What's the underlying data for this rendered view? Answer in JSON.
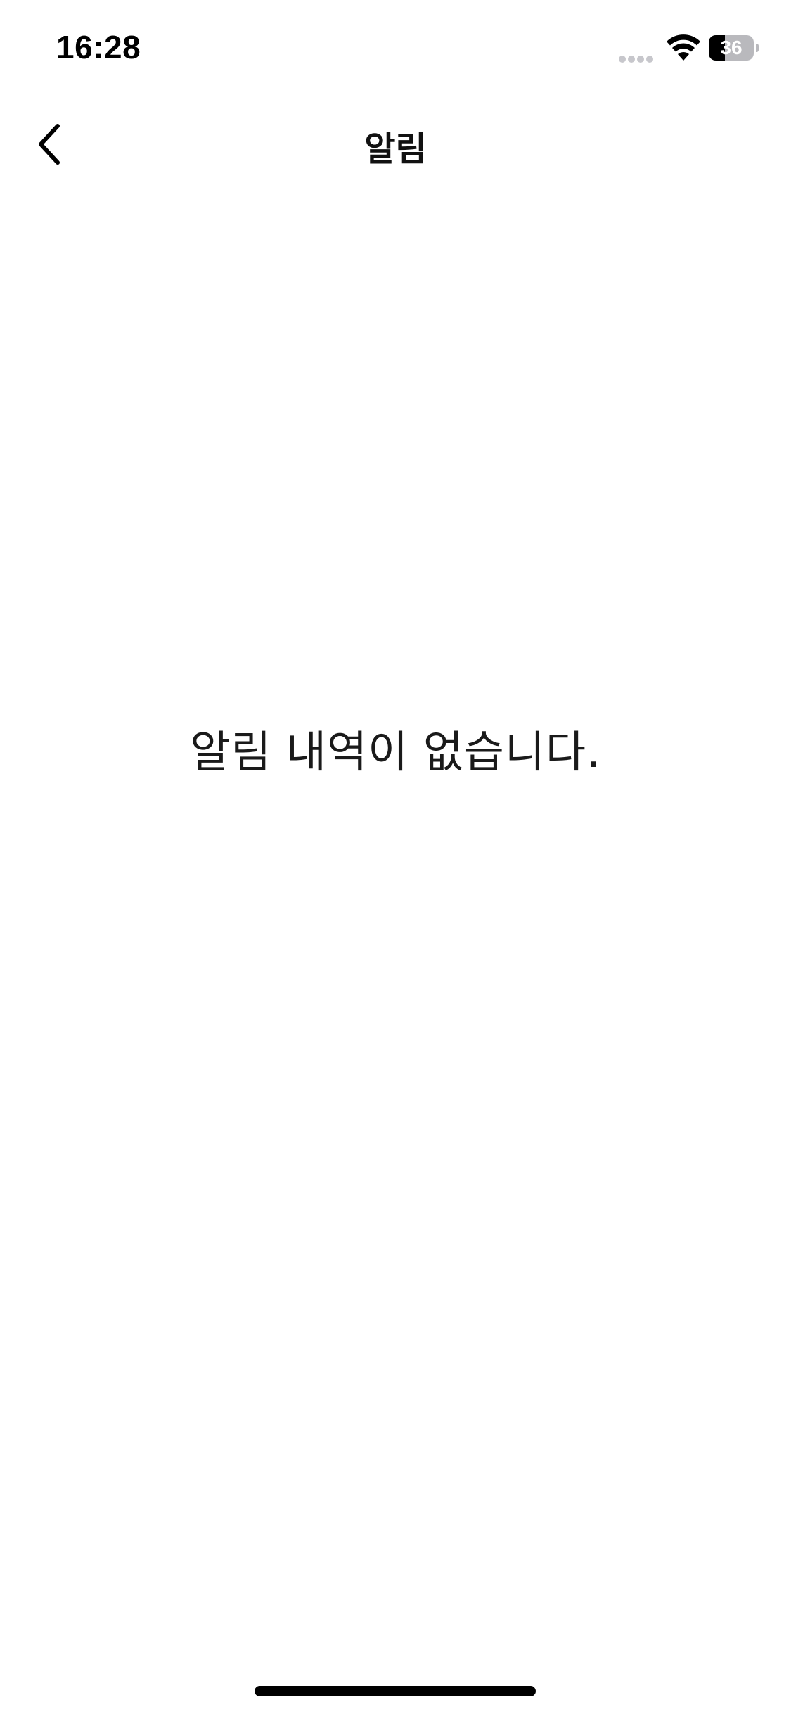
{
  "status_bar": {
    "time": "16:28",
    "battery_level": "36",
    "battery_fraction": 0.36,
    "icons": [
      "signal-icon",
      "wifi-icon",
      "battery-icon"
    ]
  },
  "nav": {
    "title": "알림",
    "back_icon": "chevron-left-icon"
  },
  "empty_state": {
    "message": "알림 내역이 없습니다."
  },
  "colors": {
    "background": "#ffffff",
    "text": "#111111",
    "status_inactive": "#c7c7cc"
  }
}
